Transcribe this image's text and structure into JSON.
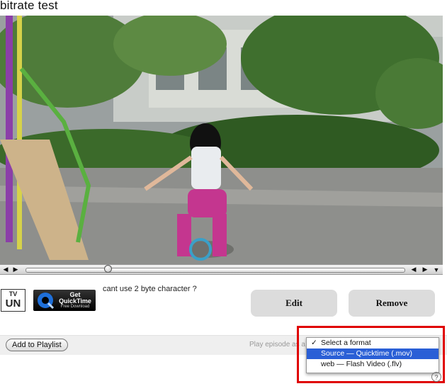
{
  "page": {
    "title": "bitrate test"
  },
  "video": {
    "progress": 0.22
  },
  "logos": {
    "un": "UN",
    "un_top": "TV",
    "qt_line1": "Get",
    "qt_line2": "QuickTime",
    "qt_sub": "Free Download"
  },
  "episode": {
    "description": "cant use 2 byte character ?"
  },
  "actions": {
    "edit_label": "Edit",
    "remove_label": "Remove"
  },
  "footer": {
    "playlist_label": "Add to Playlist",
    "play_label": "Play episode as a"
  },
  "format_menu": {
    "check": "✓",
    "options": [
      {
        "label": "Select a format",
        "checked": true
      },
      {
        "label": "Source — Quicktime (.mov)",
        "highlighted": true
      },
      {
        "label": "web — Flash Video (.flv)"
      }
    ]
  },
  "colors": {
    "highlight_border": "#e00000",
    "menu_selection": "#2a5fd6"
  },
  "icons": {
    "volume": "speaker-icon",
    "play": "play-icon",
    "rewind": "step-back-icon",
    "forward": "step-forward-icon",
    "menu": "dropdown-icon",
    "help": "help-icon"
  }
}
